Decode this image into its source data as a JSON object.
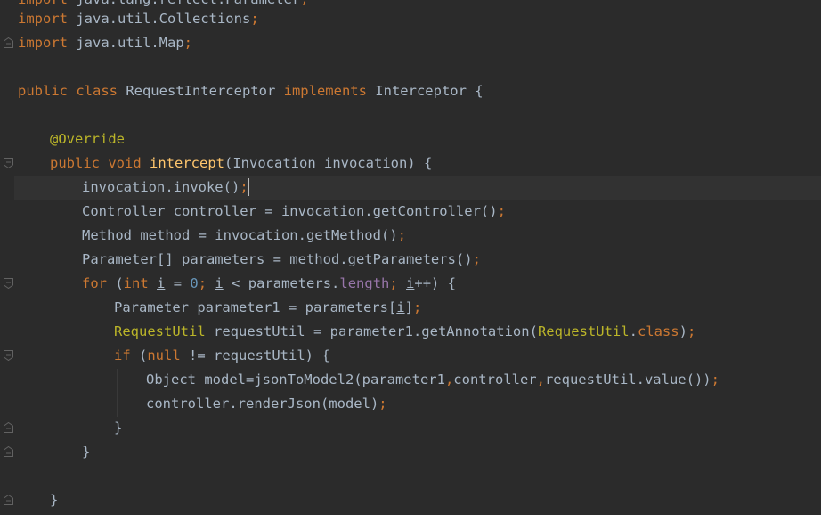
{
  "theme": {
    "background": "#2b2b2b",
    "text": "#a9b7c6",
    "keyword": "#cc7832",
    "annotation": "#bbb529",
    "method_declaration": "#ffc66d",
    "number": "#6897bb",
    "field": "#9876aa",
    "caret_line": "#323232"
  },
  "code": {
    "l0": {
      "t1": "import",
      "t2": " java.lang.reflect.Parameter",
      "t3": ";"
    },
    "l1": {
      "t1": "import",
      "t2": " java.util.Collections",
      "t3": ";"
    },
    "l2": {
      "t1": "import",
      "t2": " java.util.Map",
      "t3": ";"
    },
    "l4": {
      "t1": "public class",
      "t2": " RequestInterceptor ",
      "t3": "implements",
      "t4": " Interceptor {"
    },
    "l6": {
      "t1": "@Override"
    },
    "l7": {
      "t1": "public void",
      "t2": " ",
      "t3": "intercept",
      "t4": "(Invocation invocation) {"
    },
    "l8": {
      "t1": "invocation.invoke()",
      "t2": ";"
    },
    "l9": {
      "t1": "Controller controller = invocation.getController()",
      "t2": ";"
    },
    "l10": {
      "t1": "Method method = invocation.getMethod()",
      "t2": ";"
    },
    "l11": {
      "t1": "Parameter[] parameters = method.getParameters()",
      "t2": ";"
    },
    "l12": {
      "t1": "for",
      "t2": " (",
      "t3": "int",
      "t4": " ",
      "t5": "i",
      "t6": " = ",
      "t7": "0",
      "t8": "; ",
      "t9": "i",
      "t10": " < parameters.",
      "t11": "length",
      "t12": "; ",
      "t13": "i",
      "t14": "++) {"
    },
    "l13": {
      "t1": "Parameter parameter1 = parameters[",
      "t2": "i",
      "t3": "]",
      "t4": ";"
    },
    "l14": {
      "t1": "RequestUtil",
      "t2": " requestUtil = parameter1.getAnnotation(",
      "t3": "RequestUtil",
      "t4": ".",
      "t5": "class",
      "t6": ")",
      "t7": ";"
    },
    "l15": {
      "t1": "if",
      "t2": " (",
      "t3": "null",
      "t4": " != requestUtil) {"
    },
    "l16": {
      "t1": "Object model=jsonToModel2(parameter1",
      "t2": ",",
      "t3": "controller",
      "t4": ",",
      "t5": "requestUtil.value())",
      "t6": ";"
    },
    "l17": {
      "t1": "controller.renderJson(model)",
      "t2": ";"
    },
    "l18": {
      "t1": "}"
    },
    "l19": {
      "t1": "}"
    },
    "l21": {
      "t1": "}"
    }
  },
  "gutter": {
    "fold_icon": "fold-marker-icon"
  }
}
